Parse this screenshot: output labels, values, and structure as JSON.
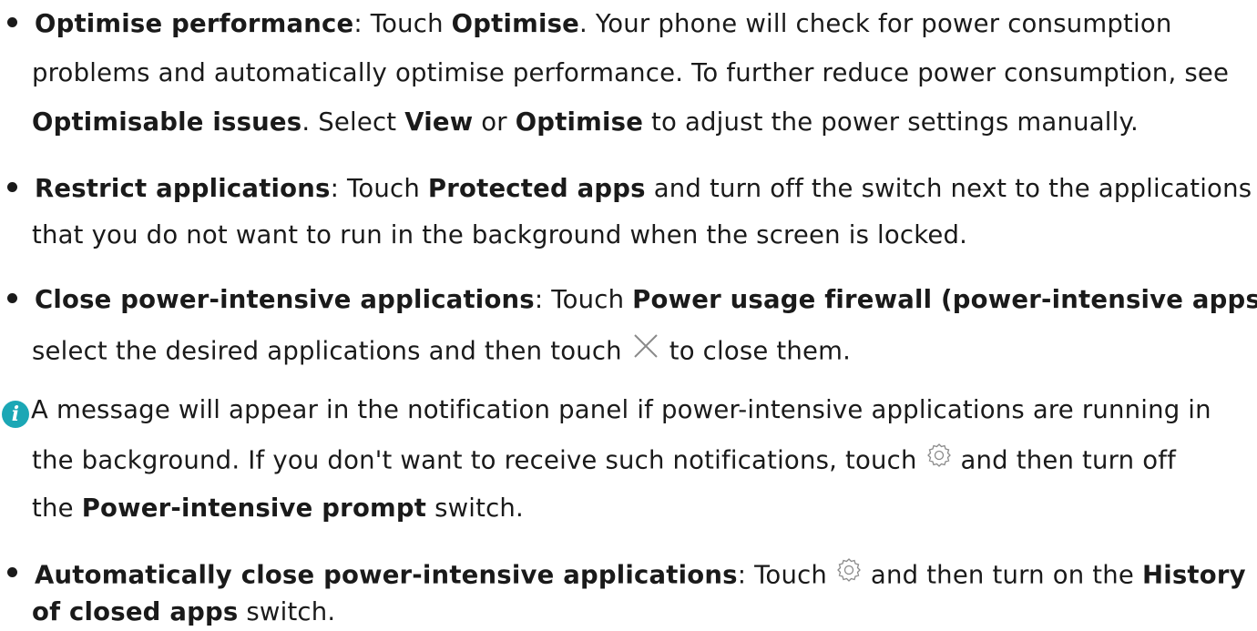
{
  "items": {
    "optimise": {
      "title": "Optimise performance",
      "l1_a": ": Touch ",
      "l1_b": "Optimise",
      "l1_c": ". Your phone will check for power consumption",
      "l2": "problems and automatically optimise performance. To further reduce power consumption, see",
      "l3_a": "Optimisable issues",
      "l3_b": ". Select ",
      "l3_c": "View",
      "l3_d": " or ",
      "l3_e": "Optimise",
      "l3_f": " to adjust the power settings manually."
    },
    "restrict": {
      "title": "Restrict applications",
      "l1_a": ": Touch ",
      "l1_b": "Protected apps",
      "l1_c": " and turn off the switch next to the applications",
      "l2": "that you do not want to run in the background when the screen is locked."
    },
    "close": {
      "title": "Close power-intensive applications",
      "l1_a": ": Touch ",
      "l1_b": "Power usage firewall (power-intensive apps)",
      "l1_c": ",",
      "l2_a": "select the desired applications and then touch ",
      "l2_b": " to close them."
    },
    "note": {
      "icon_glyph": "i",
      "l1": "A message will appear in the notification panel if power-intensive applications are running in",
      "l2_a": "the background. If you don't want to receive such notifications, touch ",
      "l2_b": " and then turn off",
      "l3_a": "the ",
      "l3_b": "Power-intensive prompt",
      "l3_c": " switch."
    },
    "auto_close": {
      "title": "Automatically close power-intensive applications",
      "l1_a": ": Touch ",
      "l1_b": " and then turn on the ",
      "l1_c": "History",
      "l2_a": "of closed apps",
      "l2_b": " switch."
    }
  },
  "colors": {
    "text": "#1a1a1a",
    "note_icon": "#1ba7b5",
    "icon_stroke": "#8a8a8a"
  },
  "icons": {
    "close": "close-x-icon",
    "settings": "gear-icon",
    "note": "info-icon"
  }
}
